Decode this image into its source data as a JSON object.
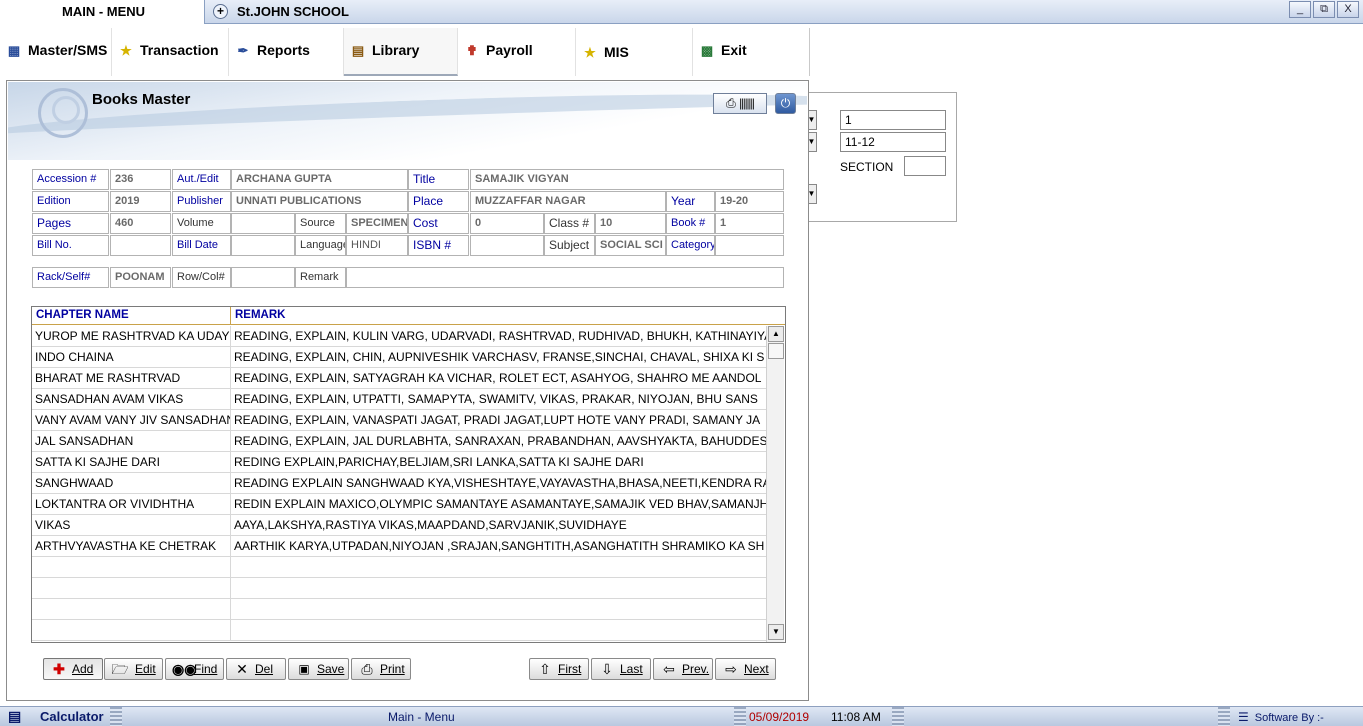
{
  "tabs": {
    "main_label": "MAIN - MENU",
    "school_label": "St.JOHN SCHOOL",
    "add_icon": "plus-circle-icon"
  },
  "window_controls": [
    "_",
    "⧉",
    "X"
  ],
  "menu": [
    {
      "label": "Master/SMS",
      "icon": "users-icon"
    },
    {
      "label": "Transaction",
      "icon": "star-icon"
    },
    {
      "label": "Reports",
      "icon": "report-icon"
    },
    {
      "label": "Library",
      "icon": "books-icon"
    },
    {
      "label": "Payroll",
      "icon": "payroll-icon"
    },
    {
      "label": "MIS",
      "icon": "star-icon"
    },
    {
      "label": "Exit",
      "icon": "exit-icon"
    }
  ],
  "background_panel": {
    "field1": "1",
    "field2": "11-12",
    "section_label": "SECTION",
    "section_value": ""
  },
  "window": {
    "title": "Books Master"
  },
  "form": {
    "accession_label": "Accession #",
    "accession_value": "236",
    "author_label": "Aut./Edit",
    "author_value": "ARCHANA GUPTA",
    "title_label": "Title",
    "title_value": "SAMAJIK   VIGYAN",
    "edition_label": "Edition",
    "edition_value": "2019",
    "publisher_label": "Publisher",
    "publisher_value": "UNNATI PUBLICATIONS",
    "place_label": "Place",
    "place_value": "MUZZAFFAR NAGAR",
    "year_label": "Year",
    "year_value": "19-20",
    "pages_label": "Pages",
    "pages_value": "460",
    "volume_label": "Volume",
    "volume_value": "",
    "source_label": "Source",
    "source_value": "SPECIMEN",
    "cost_label": "Cost",
    "cost_value": "0",
    "class_label": "Class #",
    "class_value": "10",
    "book_label": "Book #",
    "book_value": "1",
    "bill_no_label": "Bill No.",
    "bill_no_value": "",
    "bill_date_label": "Bill Date",
    "bill_date_value": "",
    "language_label": "Language",
    "language_value": "HINDI",
    "isbn_label": "ISBN #",
    "isbn_value": "",
    "subject_label": "Subject",
    "subject_value": "SOCIAL  SCI",
    "category_label": "Category",
    "category_value": "",
    "rack_label": "Rack/Self#",
    "rack_value": "POONAM",
    "rowcol_label": "Row/Col#",
    "rowcol_value": "",
    "remark_label": "Remark",
    "remark_value": ""
  },
  "grid": {
    "headers": [
      "CHAPTER NAME",
      "REMARK"
    ],
    "rows": [
      [
        "YUROP ME RASHTRVAD KA UDAY",
        "READING, EXPLAIN, KULIN VARG, UDARVADI, RASHTRVAD, RUDHIVAD, BHUKH, KATHINAYIYA"
      ],
      [
        "INDO CHAINA",
        "READING, EXPLAIN, CHIN, AUPNIVESHIK VARCHASV, FRANSE,SINCHAI, CHAVAL, SHIXA KI S"
      ],
      [
        "BHARAT ME RASHTRVAD",
        "READING, EXPLAIN, SATYAGRAH KA VICHAR, ROLET ECT, ASAHYOG, SHAHRO ME AANDOL"
      ],
      [
        "SANSADHAN AVAM VIKAS",
        "READING, EXPLAIN, UTPATTI, SAMAPYTA, SWAMITV, VIKAS, PRAKAR, NIYOJAN, BHU SANS"
      ],
      [
        "VANY AVAM VANY JIV SANSADHAN",
        "READING, EXPLAIN, VANASPATI JAGAT, PRADI JAGAT,LUPT HOTE VANY PRADI, SAMANY JA"
      ],
      [
        "JAL SANSADHAN",
        "READING, EXPLAIN, JAL DURLABHTA, SANRAXAN, PRABANDHAN, AAVSHYAKTA, BAHUDDES"
      ],
      [
        "SATTA KI SAJHE DARI",
        "REDING EXPLAIN,PARICHAY,BELJIAM,SRI LANKA,SATTA KI SAJHE DARI"
      ],
      [
        "SANGHWAAD",
        "READING EXPLAIN SANGHWAAD KYA,VISHESHTAYE,VAYAVASTHA,BHASA,NEETI,KENDRA RA"
      ],
      [
        "LOKTANTRA OR VIVIDHTHA",
        "REDIN EXPLAIN MAXICO,OLYMPIC SAMANTAYE ASAMANTAYE,SAMAJIK VED BHAV,SAMANJH"
      ],
      [
        "VIKAS",
        "AAYA,LAKSHYA,RASTIYA VIKAS,MAAPDAND,SARVJANIK,SUVIDHAYE"
      ],
      [
        "ARTHVYAVASTHA KE CHETRAK",
        "AARTHIK KARYA,UTPADAN,NIYOJAN ,SRAJAN,SANGHTITH,ASANGHATITH SHRAMIKO KA SH"
      ],
      [
        "",
        ""
      ],
      [
        "",
        ""
      ],
      [
        "",
        ""
      ],
      [
        "",
        ""
      ]
    ]
  },
  "actions": [
    {
      "label": "Add",
      "icon": "plus-icon"
    },
    {
      "label": "Edit",
      "icon": "folder-open-icon"
    },
    {
      "label": "Find",
      "icon": "binoculars-icon"
    },
    {
      "label": "Del",
      "icon": "delete-icon"
    },
    {
      "label": "Save",
      "icon": "floppy-icon"
    },
    {
      "label": "Print",
      "icon": "printer-icon"
    }
  ],
  "navigation": [
    {
      "label": "First",
      "icon": "arrow-up-icon"
    },
    {
      "label": "Last",
      "icon": "arrow-down-icon"
    },
    {
      "label": "Prev.",
      "icon": "arrow-left-icon"
    },
    {
      "label": "Next",
      "icon": "arrow-right-icon"
    }
  ],
  "taskbar": {
    "calculator_label": "Calculator",
    "main_menu_label": "Main - Menu",
    "date": "05/09/2019",
    "time": "11:08 AM",
    "software_label": "Software By :-"
  },
  "colors": {
    "label_blue": "#0000a0",
    "date_red": "#b00000",
    "grid_header_border": "#c9a24a"
  }
}
